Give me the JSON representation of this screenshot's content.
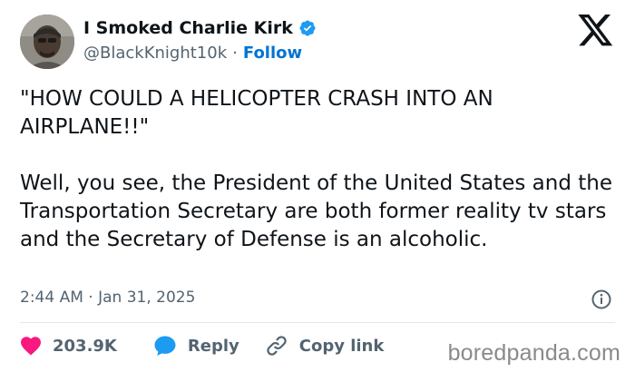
{
  "tweet": {
    "author": {
      "display_name": "I Smoked Charlie Kirk",
      "handle": "@BlackKnight10k",
      "verified": true,
      "avatar_icon": "profile-photo"
    },
    "separator": "·",
    "follow_label": "Follow",
    "brand_icon": "x-logo-icon",
    "text_paragraphs": [
      "\"HOW COULD A HELICOPTER CRASH INTO AN AIRPLANE!!\"",
      "Well, you see, the President of the United States and the Transportation Secretary are both former reality tv stars and the Secretary of Defense is an alcoholic."
    ],
    "timestamp": "2:44 AM · Jan 31, 2025",
    "info_icon": "info-icon",
    "actions": {
      "likes": "203.9K",
      "reply_label": "Reply",
      "copy_link_label": "Copy link"
    }
  },
  "watermark": "boredpanda.com",
  "colors": {
    "text": "#0f1419",
    "secondary": "#536471",
    "link": "#0074d4",
    "heart": "#f91880",
    "reply_bubble": "#1d9bf0",
    "verified": "#1d9bf0",
    "divider": "#e1e8ed"
  }
}
